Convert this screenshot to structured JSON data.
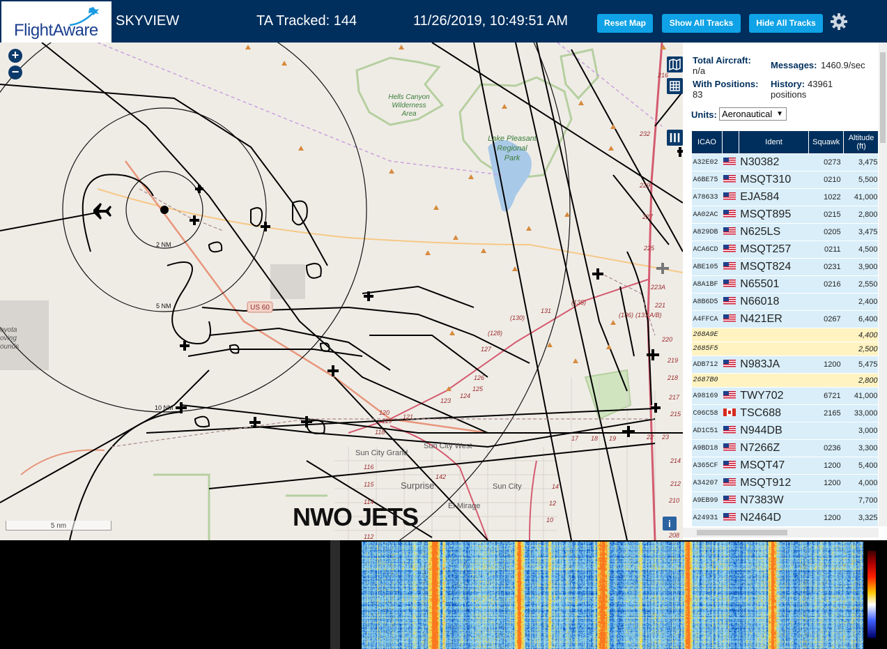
{
  "header": {
    "logo_text": "FlightAware",
    "app_name": "SKYVIEW",
    "tracked_label": "TA Tracked: 144",
    "datetime": "11/26/2019, 10:49:51 AM",
    "buttons": {
      "reset": "Reset Map",
      "show_all": "Show All Tracks",
      "hide_all": "Hide All Tracks"
    },
    "settings_icon": "gear-icon"
  },
  "map": {
    "zoom_in": "+",
    "zoom_out": "−",
    "watermark": "NWO JETS",
    "scale_label": "5 nm",
    "info": "i",
    "range_labels": [
      "2 NM",
      "5 NM",
      "10 NM"
    ],
    "place_labels": {
      "hells_canyon": [
        "Hells Canyon",
        "Wilderness",
        "Area"
      ],
      "lake_pleasant": [
        "Lake Pleasant",
        "Regional",
        "Park"
      ],
      "sun_city_grand": "Sun City Grand",
      "sun_city_west": "Sun City West",
      "surprise": "Surprise",
      "sun_city": "Sun City",
      "el_mirage": "El Mirage",
      "us60": "US 60",
      "coyota": [
        "oyota",
        "oving",
        "ounds"
      ]
    },
    "road_labels": [
      "(130)",
      "(135)",
      "(128)",
      "(136)",
      "(133 A/B)",
      "131",
      "127",
      "125",
      "123",
      "121",
      "119",
      "142",
      "116",
      "115",
      "114",
      "14",
      "12",
      "10",
      "18",
      "19",
      "17",
      "22",
      "23",
      "215",
      "229",
      "227",
      "225",
      "223A",
      "221",
      "220",
      "219",
      "218",
      "217",
      "232",
      "216",
      "214",
      "212",
      "210",
      "208",
      "112",
      "126",
      "124",
      "120",
      "118"
    ]
  },
  "sidebar": {
    "total_aircraft_label": "Total Aircraft:",
    "total_aircraft_value": "n/a",
    "with_positions_label": "With Positions:",
    "with_positions_value": "83",
    "messages_label": "Messages:",
    "messages_value": "1460.9/sec",
    "history_label": "History:",
    "history_value": "43961",
    "history_unit": "positions",
    "units_label": "Units:",
    "units_value": "Aeronautical",
    "columns": [
      "ICAO",
      "",
      "Ident",
      "Squawk",
      "Altitude (ft)"
    ],
    "rows": [
      {
        "icao": "A32E02",
        "flag": "us",
        "ident": "N30382",
        "squawk": "0273",
        "alt": "3,475"
      },
      {
        "icao": "A6BE75",
        "flag": "us",
        "ident": "MSQT310",
        "squawk": "0210",
        "alt": "5,500"
      },
      {
        "icao": "A78633",
        "flag": "us",
        "ident": "EJA584",
        "squawk": "1022",
        "alt": "41,000"
      },
      {
        "icao": "AA02AC",
        "flag": "us",
        "ident": "MSQT895",
        "squawk": "0215",
        "alt": "2,800"
      },
      {
        "icao": "A829DB",
        "flag": "us",
        "ident": "N625LS",
        "squawk": "0205",
        "alt": "3,475"
      },
      {
        "icao": "ACA6CD",
        "flag": "us",
        "ident": "MSQT257",
        "squawk": "0211",
        "alt": "4,500"
      },
      {
        "icao": "ABE105",
        "flag": "us",
        "ident": "MSQT824",
        "squawk": "0231",
        "alt": "3,900"
      },
      {
        "icao": "A8A1BF",
        "flag": "us",
        "ident": "N65501",
        "squawk": "0216",
        "alt": "2,550"
      },
      {
        "icao": "A8B6D5",
        "flag": "us",
        "ident": "N66018",
        "squawk": "",
        "alt": "2,400"
      },
      {
        "icao": "A4FFCA",
        "flag": "us",
        "ident": "N421ER",
        "squawk": "0267",
        "alt": "6,400"
      },
      {
        "icao": "268A9E",
        "flag": "",
        "ident": "",
        "squawk": "",
        "alt": "4,400",
        "mlat": true
      },
      {
        "icao": "2685F5",
        "flag": "",
        "ident": "",
        "squawk": "",
        "alt": "2,500",
        "mlat": true
      },
      {
        "icao": "ADB712",
        "flag": "us",
        "ident": "N983JA",
        "squawk": "1200",
        "alt": "5,475"
      },
      {
        "icao": "2687B0",
        "flag": "",
        "ident": "",
        "squawk": "",
        "alt": "2,800",
        "mlat": true
      },
      {
        "icao": "A98169",
        "flag": "us",
        "ident": "TWY702",
        "squawk": "6721",
        "alt": "41,000"
      },
      {
        "icao": "C06C58",
        "flag": "ca",
        "ident": "TSC688",
        "squawk": "2165",
        "alt": "33,000"
      },
      {
        "icao": "AD1C51",
        "flag": "us",
        "ident": "N944DB",
        "squawk": "",
        "alt": "3,000"
      },
      {
        "icao": "A9BD18",
        "flag": "us",
        "ident": "N7266Z",
        "squawk": "0236",
        "alt": "3,300"
      },
      {
        "icao": "A365CF",
        "flag": "us",
        "ident": "MSQT47",
        "squawk": "1200",
        "alt": "5,400"
      },
      {
        "icao": "A34207",
        "flag": "us",
        "ident": "MSQT912",
        "squawk": "1200",
        "alt": "4,000"
      },
      {
        "icao": "A9EB99",
        "flag": "us",
        "ident": "N7383W",
        "squawk": "",
        "alt": "7,700"
      },
      {
        "icao": "A24931",
        "flag": "us",
        "ident": "N2464D",
        "squawk": "1200",
        "alt": "3,325"
      }
    ]
  },
  "colors": {
    "header_bg": "#002f5d",
    "button_bg": "#0fa2e6",
    "row_bg": "#d9eef9",
    "mlat_row_bg": "#fff3c1"
  }
}
